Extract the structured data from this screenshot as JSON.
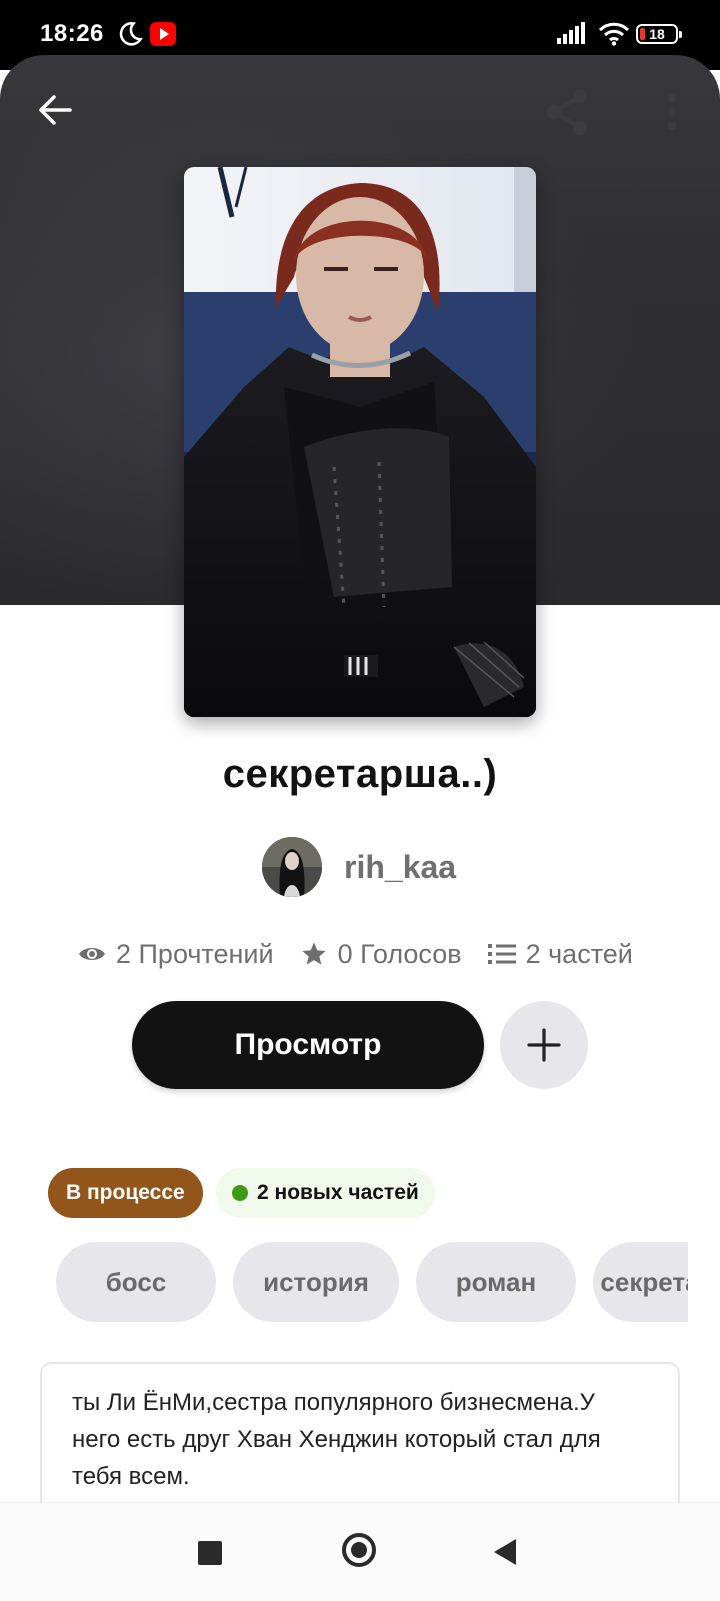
{
  "status_bar": {
    "time": "18:26",
    "battery": "18"
  },
  "story": {
    "title": "секретарша..)",
    "author": "rih_kaa",
    "stats": {
      "reads": "2 Прочтений",
      "votes": "0 Голосов",
      "parts": "2 частей"
    },
    "read_button": "Просмотр",
    "status_badge": "В процессе",
    "new_parts_badge": "2 новых частей",
    "tags": [
      "босс",
      "история",
      "роман",
      "секретарша"
    ],
    "description": "ты Ли ЁнМи,сестра популярного бизнесмена.У него есть друг Хван Хенджин который стал для тебя всем."
  },
  "icons": {
    "back": "arrow-left-icon",
    "share": "share-icon",
    "more": "more-vertical-icon",
    "reads": "eye-icon",
    "votes": "star-icon",
    "parts": "list-icon",
    "add": "plus-icon"
  },
  "colors": {
    "accent_dark": "#121212",
    "status_in_progress": "#93561a",
    "new_parts_dot": "#3a9c14",
    "tag_bg": "#e7e6eb",
    "hero_bg": "#2f2f33"
  }
}
